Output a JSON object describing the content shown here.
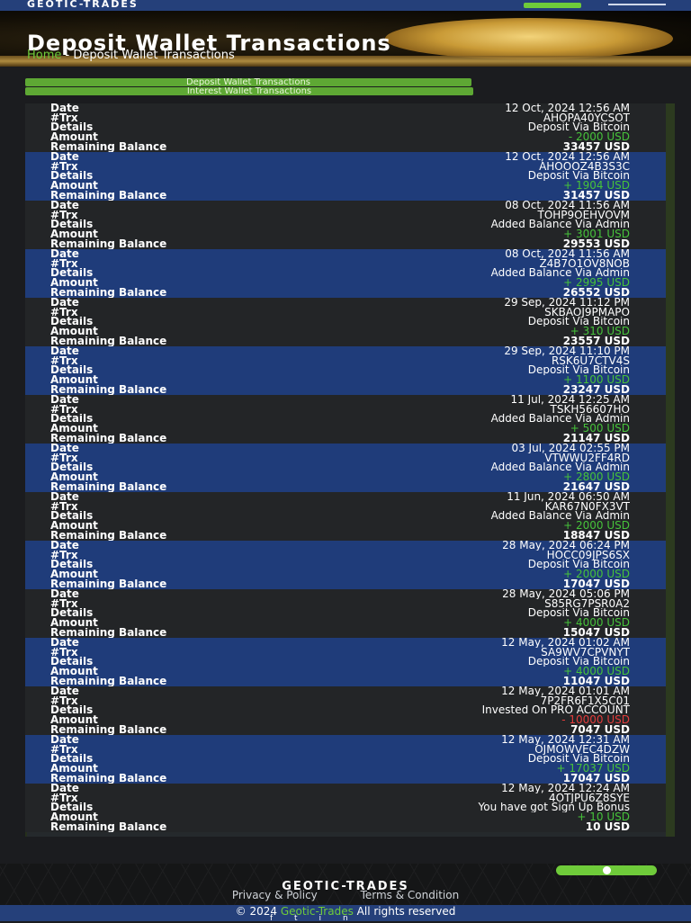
{
  "header": {
    "brand": "GEOTIC-TRADES",
    "page_title": "Deposit Wallet Transactions",
    "breadcrumb_home": "Home",
    "breadcrumb_current": "Deposit Wallet Transactions"
  },
  "tabs": [
    {
      "label": "Deposit Wallet Transactions"
    },
    {
      "label": "Interest Wallet Transactions"
    }
  ],
  "labels": {
    "date": "Date",
    "trx": "#Trx",
    "details": "Details",
    "amount": "Amount",
    "balance": "Remaining Balance"
  },
  "transactions": [
    {
      "date": "12 Oct, 2024 12:56 AM",
      "trx": "AHOPA40YCSOT",
      "details": "Deposit Via Bitcoin",
      "amount": "- 2000 USD",
      "amount_type": "debit",
      "balance": "33457 USD"
    },
    {
      "date": "12 Oct, 2024 12:56 AM",
      "trx": "AHOOOZ4B3S3C",
      "details": "Deposit Via Bitcoin",
      "amount": "+ 1904 USD",
      "amount_type": "credit",
      "balance": "31457 USD"
    },
    {
      "date": "08 Oct, 2024 11:56 AM",
      "trx": "TOHP9OEHVOVM",
      "details": "Added Balance Via Admin",
      "amount": "+ 3001 USD",
      "amount_type": "credit",
      "balance": "29553 USD"
    },
    {
      "date": "08 Oct, 2024 11:56 AM",
      "trx": "Z4B7O1OV8NOB",
      "details": "Added Balance Via Admin",
      "amount": "+ 2995 USD",
      "amount_type": "credit",
      "balance": "26552 USD"
    },
    {
      "date": "29 Sep, 2024 11:12 PM",
      "trx": "SKBAOJ9PMAPO",
      "details": "Deposit Via Bitcoin",
      "amount": "+ 310 USD",
      "amount_type": "credit",
      "balance": "23557 USD"
    },
    {
      "date": "29 Sep, 2024 11:10 PM",
      "trx": "RSK6U7CTV4S",
      "details": "Deposit Via Bitcoin",
      "amount": "+ 1100 USD",
      "amount_type": "credit",
      "balance": "23247 USD"
    },
    {
      "date": "11 Jul, 2024 12:25 AM",
      "trx": "TSKH56607HO",
      "details": "Added Balance Via Admin",
      "amount": "+ 500 USD",
      "amount_type": "credit",
      "balance": "21147 USD"
    },
    {
      "date": "03 Jul, 2024 02:55 PM",
      "trx": "VTWWU2FF4RD",
      "details": "Added Balance Via Admin",
      "amount": "+ 2800 USD",
      "amount_type": "credit",
      "balance": "21647 USD"
    },
    {
      "date": "11 Jun, 2024 06:50 AM",
      "trx": "KAR67N0FX3VT",
      "details": "Added Balance Via Admin",
      "amount": "+ 2000 USD",
      "amount_type": "credit",
      "balance": "18847 USD"
    },
    {
      "date": "28 May, 2024 06:24 PM",
      "trx": "HOCC09JPS6SX",
      "details": "Deposit Via Bitcoin",
      "amount": "+ 2000 USD",
      "amount_type": "credit",
      "balance": "17047 USD"
    },
    {
      "date": "28 May, 2024 05:06 PM",
      "trx": "S85RG7PSR0A2",
      "details": "Deposit Via Bitcoin",
      "amount": "+ 4000 USD",
      "amount_type": "credit",
      "balance": "15047 USD"
    },
    {
      "date": "12 May, 2024 01:02 AM",
      "trx": "SA9WV7CPVNYT",
      "details": "Deposit Via Bitcoin",
      "amount": "+ 4000 USD",
      "amount_type": "credit",
      "balance": "11047 USD"
    },
    {
      "date": "12 May, 2024 01:01 AM",
      "trx": "7P2FR6F1X5C01",
      "details": "Invested On PRO ACCOUNT",
      "amount": "- 10000 USD",
      "amount_type": "debit",
      "balance": "7047 USD"
    },
    {
      "date": "12 May, 2024 12:31 AM",
      "trx": "OJMOWVEC4DZW",
      "details": "Deposit Via Bitcoin",
      "amount": "+ 17037 USD",
      "amount_type": "credit",
      "balance": "17047 USD"
    },
    {
      "date": "12 May, 2024 12:24 AM",
      "trx": "4OTJPU6Z8SYE",
      "details": "You have got Sign Up Bonus",
      "amount": "+ 10 USD",
      "amount_type": "credit",
      "balance": "10 USD"
    }
  ],
  "footer": {
    "brand": "GEOTIC-TRADES",
    "privacy": "Privacy & Policy",
    "terms": "Terms & Condition",
    "copyright_prefix": "© 2024",
    "copyright_brand": "Geotic-Trades",
    "copyright_suffix": "All rights reserved"
  }
}
